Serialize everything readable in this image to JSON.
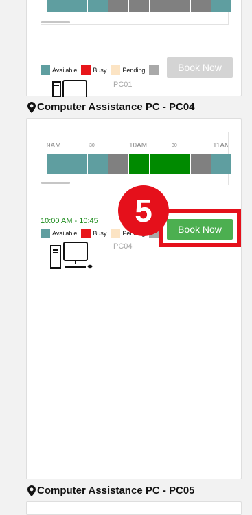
{
  "card1": {
    "legend": {
      "available": "Available",
      "busy": "Busy",
      "pending": "Pending"
    },
    "book_label": "Book Now",
    "pc_name": "PC01",
    "slots": [
      "available",
      "available",
      "available",
      "unavail",
      "unavail",
      "unavail",
      "unavail",
      "unavail",
      "available"
    ]
  },
  "section2": {
    "title": "Computer Assistance PC - PC04"
  },
  "card2": {
    "ticks": {
      "t9": "9AM",
      "t930": "30",
      "t10": "10AM",
      "t1030": "30",
      "t11": "11AM"
    },
    "slots": [
      "available",
      "available",
      "available",
      "unavail",
      "busy",
      "busy",
      "busy",
      "unavail",
      "available"
    ],
    "selected_time": "10:00 AM - 10:45",
    "legend": {
      "available": "Available",
      "busy": "Busy",
      "pending": "Pending"
    },
    "book_label": "Book Now",
    "pc_name": "PC04",
    "step_badge": "5"
  },
  "section3": {
    "title": "Computer Assistance PC - PC05"
  },
  "colors": {
    "available": "#5f9ea0",
    "busy_legend": "#e8161a",
    "busy_slot": "#008a00",
    "pending": "#fce4c4",
    "unavailable": "#808080",
    "highlight": "#e5101b",
    "book_enabled": "#4caf50"
  },
  "icons": {
    "pin": "map-pin-icon",
    "computer": "desktop-computer-icon"
  }
}
